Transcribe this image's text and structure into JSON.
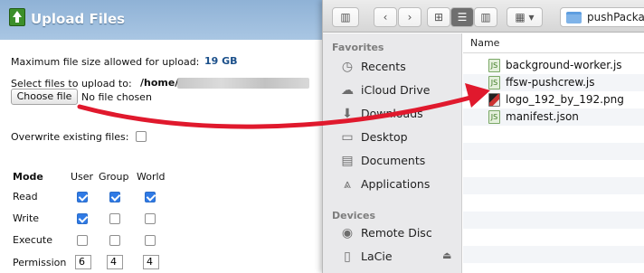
{
  "upload": {
    "title": "Upload Files",
    "max_size_label": "Maximum file size allowed for upload:",
    "max_size_value": "19 GB",
    "select_label": "Select files to upload to:",
    "path_visible": "/home/",
    "choose_button": "Choose file",
    "no_file": "No file chosen",
    "overwrite_label": "Overwrite existing files:",
    "overwrite_checked": false,
    "perm_header": {
      "mode": "Mode",
      "user": "User",
      "group": "Group",
      "world": "World"
    },
    "rows": [
      {
        "label": "Read",
        "user": true,
        "group": true,
        "world": true
      },
      {
        "label": "Write",
        "user": true,
        "group": false,
        "world": false
      },
      {
        "label": "Execute",
        "user": false,
        "group": false,
        "world": false
      }
    ],
    "permission": {
      "label": "Permission",
      "user": "6",
      "group": "4",
      "world": "4"
    }
  },
  "finder": {
    "path": "pushPackag",
    "favorites_header": "Favorites",
    "favorites": [
      {
        "label": "Recents",
        "icon": "clock-icon"
      },
      {
        "label": "iCloud Drive",
        "icon": "cloud-icon"
      },
      {
        "label": "Downloads",
        "icon": "download-icon"
      },
      {
        "label": "Desktop",
        "icon": "desktop-icon"
      },
      {
        "label": "Documents",
        "icon": "document-icon"
      },
      {
        "label": "Applications",
        "icon": "applications-icon"
      }
    ],
    "devices_header": "Devices",
    "devices": [
      {
        "label": "Remote Disc",
        "icon": "disc-icon"
      },
      {
        "label": "LaCie",
        "icon": "drive-icon"
      }
    ],
    "column_name": "Name",
    "files": [
      {
        "name": "background-worker.js",
        "icon": "js-file-icon"
      },
      {
        "name": "ffsw-pushcrew.js",
        "icon": "js-file-icon"
      },
      {
        "name": "logo_192_by_192.png",
        "icon": "png-file-icon"
      },
      {
        "name": "manifest.json",
        "icon": "json-file-icon"
      }
    ]
  },
  "colors": {
    "arrow": "#e0192d",
    "titlebar": "#9dbddd",
    "checkbox_on": "#2f7ae5"
  }
}
